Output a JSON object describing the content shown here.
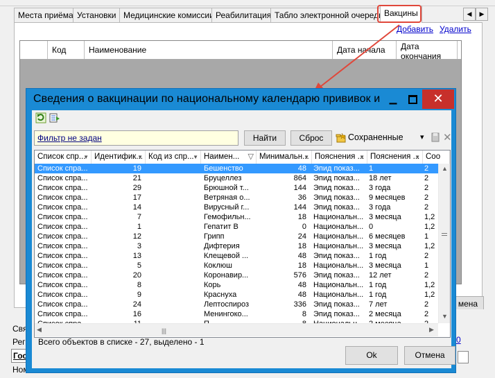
{
  "main_window": {
    "tabs": [
      {
        "label": "Места приёма"
      },
      {
        "label": "Установки"
      },
      {
        "label": "Медицинские комиссии"
      },
      {
        "label": "Реабилитация"
      },
      {
        "label": "Табло электронной очереди"
      },
      {
        "label": "Вакцины"
      }
    ],
    "active_tab": "Вакцины",
    "highlight_color": "#e0473a",
    "add_link": "Добавить",
    "delete_link": "Удалить",
    "grid_columns": [
      "Код",
      "Наименование",
      "Дата начала",
      "Дата окончания"
    ],
    "partial_button": "мена",
    "bottom_fragments": {
      "f1": "Свя",
      "f2": "Реги",
      "f3": "Гос",
      "f4": "Ном",
      "f5": "0"
    }
  },
  "dialog": {
    "title": "Сведения о вакцинации по национальному календарю прививок и ва...",
    "toolbar": {
      "refresh_icon": "refresh-icon",
      "export_icon": "export-icon",
      "filter_text": "Фильтр не задан",
      "find_label": "Найти",
      "reset_label": "Сброс",
      "saved_label": "Сохраненные",
      "saved_arrow": "▾"
    },
    "grid": {
      "columns": [
        "Список спр...",
        "Идентифик...",
        "Код из спр...",
        "Наимен...",
        "Минимальн...",
        "Пояснения ...",
        "Пояснения ...",
        "Соо"
      ],
      "rows": [
        [
          "Список спра...",
          "19",
          "",
          "Бешенство",
          "48",
          "Эпид показ...",
          "1",
          "2"
        ],
        [
          "Список спра...",
          "21",
          "",
          "Бруцеллез",
          "864",
          "Эпид показ...",
          "18 лет",
          "2"
        ],
        [
          "Список спра...",
          "29",
          "",
          "Брюшной т...",
          "144",
          "Эпид показ...",
          "3 года",
          "2"
        ],
        [
          "Список спра...",
          "17",
          "",
          "Ветряная о...",
          "36",
          "Эпид показ...",
          "9 месяцев",
          "2"
        ],
        [
          "Список спра...",
          "14",
          "",
          "Вирусный г...",
          "144",
          "Эпид показ...",
          "3 года",
          "2"
        ],
        [
          "Список спра...",
          "7",
          "",
          "Гемофильн...",
          "18",
          "Национальн...",
          "3 месяца",
          "1,2"
        ],
        [
          "Список спра...",
          "1",
          "",
          "Гепатит В",
          "0",
          "Национальн...",
          "0",
          "1,2"
        ],
        [
          "Список спра...",
          "12",
          "",
          "Грипп",
          "24",
          "Национальн...",
          "6 месяцев",
          "1"
        ],
        [
          "Список спра...",
          "3",
          "",
          "Дифтерия",
          "18",
          "Национальн...",
          "3 месяца",
          "1,2"
        ],
        [
          "Список спра...",
          "13",
          "",
          "Клещевой ...",
          "48",
          "Эпид показ...",
          "1 год",
          "2"
        ],
        [
          "Список спра...",
          "5",
          "",
          "Коклюш",
          "18",
          "Национальн...",
          "3 месяца",
          "1"
        ],
        [
          "Список спра...",
          "20",
          "",
          "Коронавир...",
          "576",
          "Эпид показ...",
          "12 лет",
          "2"
        ],
        [
          "Список спра...",
          "8",
          "",
          "Корь",
          "48",
          "Национальн...",
          "1 год",
          "1,2"
        ],
        [
          "Список спра...",
          "9",
          "",
          "Краснуха",
          "48",
          "Национальн...",
          "1 год",
          "1,2"
        ],
        [
          "Список спра...",
          "24",
          "",
          "Лептоспироз",
          "336",
          "Эпид показ...",
          "7 лет",
          "2"
        ],
        [
          "Список спра...",
          "16",
          "",
          "Менингоко...",
          "8",
          "Эпид показ...",
          "2 месяца",
          "2"
        ],
        [
          "Список спра...",
          "11",
          "",
          "П...",
          "8",
          "Национальн...",
          "2 месяца",
          "2"
        ]
      ],
      "selected_row": 0,
      "selection_color": "#3399ff"
    },
    "status_text": "Всего объектов в списке - 27, выделено - 1",
    "ok_label": "Ok",
    "cancel_label": "Отмена"
  }
}
